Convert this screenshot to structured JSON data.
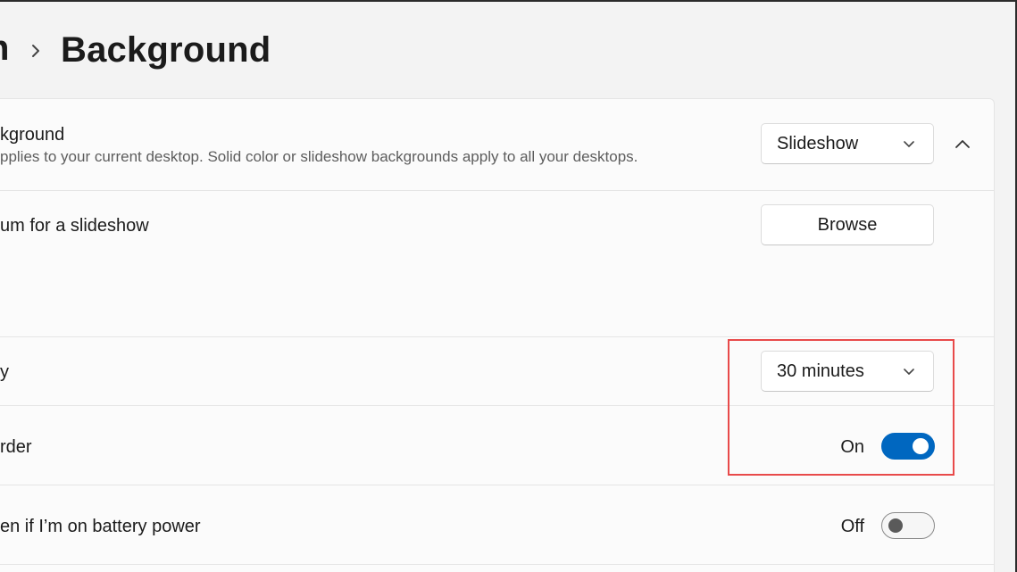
{
  "header": {
    "breadcrumb_prev_fragment": "n",
    "title": "Background"
  },
  "background_row": {
    "title": "kground",
    "subtitle": "pplies to your current desktop. Solid color or slideshow backgrounds apply to all your desktops.",
    "dropdown_value": "Slideshow"
  },
  "album_row": {
    "title": "um for a slideshow",
    "button_label": "Browse"
  },
  "interval_row": {
    "title": "y",
    "dropdown_value": "30 minutes"
  },
  "shuffle_row": {
    "title": "rder",
    "toggle_state_label": "On",
    "toggle_on": true
  },
  "battery_row": {
    "title": "en if I’m on battery power",
    "toggle_state_label": "Off",
    "toggle_on": false
  },
  "colors": {
    "accent": "#0067c0",
    "highlight": "#e84a4a"
  },
  "icons": {
    "breadcrumb_separator": "chevron-right-icon",
    "dropdown": "chevron-down-icon",
    "collapse": "chevron-up-icon"
  }
}
